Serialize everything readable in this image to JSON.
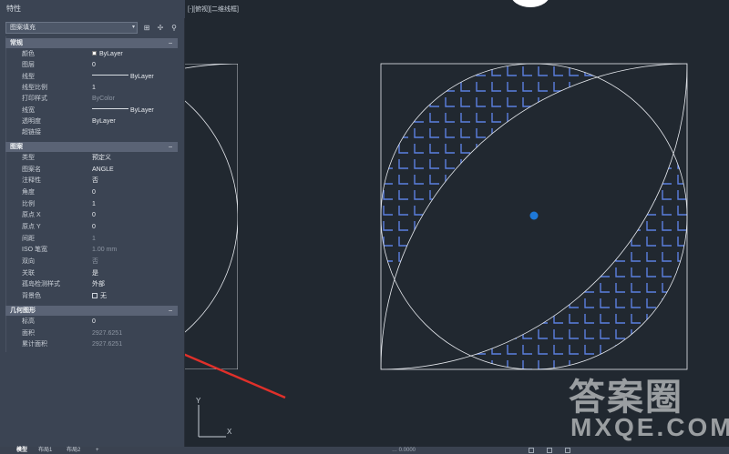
{
  "palette": {
    "title": "特性",
    "object_type": "图案填充",
    "sections": {
      "general": {
        "header": "常规",
        "rows": [
          {
            "name": "颜色",
            "value": "ByLayer"
          },
          {
            "name": "图层",
            "value": "0"
          },
          {
            "name": "线型",
            "value": "ByLayer"
          },
          {
            "name": "线型比例",
            "value": "1"
          },
          {
            "name": "打印样式",
            "value": "ByColor"
          },
          {
            "name": "线宽",
            "value": "ByLayer"
          },
          {
            "name": "透明度",
            "value": "ByLayer"
          },
          {
            "name": "超链接",
            "value": ""
          }
        ]
      },
      "pattern": {
        "header": "图案",
        "rows": [
          {
            "name": "类型",
            "value": "预定义"
          },
          {
            "name": "图案名",
            "value": "ANGLE"
          },
          {
            "name": "注释性",
            "value": "否"
          },
          {
            "name": "角度",
            "value": "0"
          },
          {
            "name": "比例",
            "value": "1"
          },
          {
            "name": "原点 X",
            "value": "0"
          },
          {
            "name": "原点 Y",
            "value": "0"
          },
          {
            "name": "间距",
            "value": "1"
          },
          {
            "name": "ISO 笔宽",
            "value": "1.00 mm"
          },
          {
            "name": "双向",
            "value": "否"
          },
          {
            "name": "关联",
            "value": "是"
          },
          {
            "name": "孤岛检测样式",
            "value": "外部"
          },
          {
            "name": "背景色",
            "value": "无"
          }
        ]
      },
      "geometry": {
        "header": "几何图形",
        "rows": [
          {
            "name": "标高",
            "value": "0"
          },
          {
            "name": "面积",
            "value": "2927.6251"
          },
          {
            "name": "累计面积",
            "value": "2927.6251"
          }
        ]
      }
    }
  },
  "viewport": {
    "label": "[-][俯视][二维线框]",
    "ucs_x": "X",
    "ucs_y": "Y"
  },
  "tabs": [
    "模型",
    "布局1",
    "布局2",
    "+"
  ],
  "status": {
    "coords": "… 0.0000"
  },
  "watermark": {
    "top": "答案圈",
    "bottom": "MXQE.COM"
  },
  "colors": {
    "hatch": "#5b7fe0",
    "geometry": "#e6e9ee",
    "grip": "#1e78d7",
    "arrow": "#e0302a",
    "palette_bg": "#3b4453",
    "canvas_bg": "#212830"
  }
}
